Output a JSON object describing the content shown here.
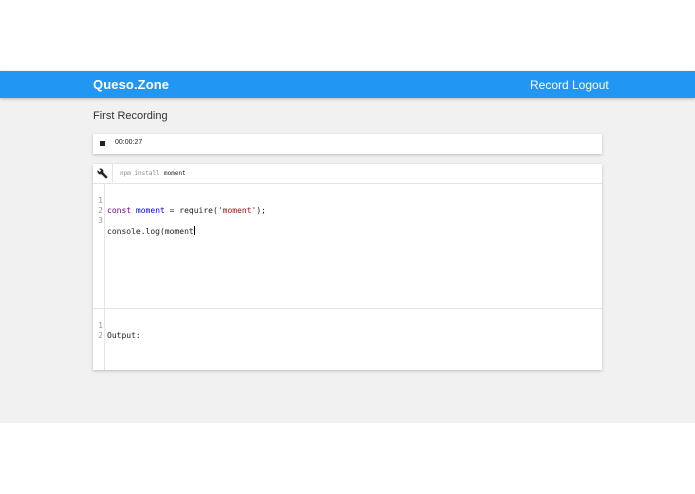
{
  "navbar": {
    "brand": "Queso.Zone",
    "links": [
      "Record",
      "Logout"
    ]
  },
  "page": {
    "title": "First Recording"
  },
  "recorder": {
    "stop_icon": "stop-icon",
    "elapsed": "00:00:27"
  },
  "editor": {
    "toolbar": {
      "settings_icon": "wrench-icon",
      "npm_label": "npm install",
      "npm_value": "moment"
    },
    "code_lines": [
      {
        "number": "1",
        "parts": [
          "const",
          " ",
          "moment",
          " = require(",
          "'moment'",
          ");"
        ]
      },
      {
        "number": "2",
        "text": ""
      },
      {
        "number": "3",
        "text": "console.log(moment"
      }
    ],
    "output_lines": [
      {
        "number": "1",
        "text": "Output:"
      },
      {
        "number": "2",
        "text": ""
      }
    ]
  },
  "colors": {
    "navbar": "#2196f3",
    "background": "#f1f1f1",
    "keyword": "#770088",
    "variable": "#0000ff",
    "string": "#aa1111"
  }
}
